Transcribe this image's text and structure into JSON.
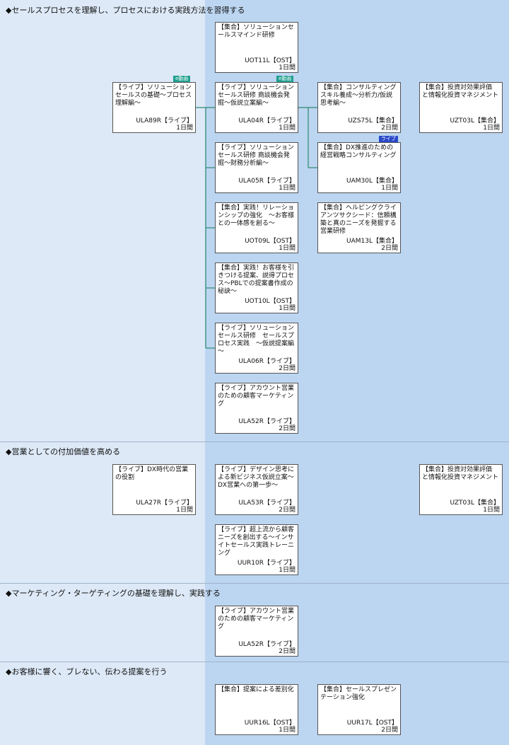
{
  "sections": [
    {
      "title": "◆セールスプロセスを理解し、プロセスにおける実践方法を習得する"
    },
    {
      "title": "◆営業としての付加価値を高める"
    },
    {
      "title": "◆マーケティング・ターゲティングの基礎を理解し、実践する"
    },
    {
      "title": "◆お客様に響く、ブレない、伝わる提案を行う"
    }
  ],
  "badges": {
    "video": "e動画",
    "live": "ライブ"
  },
  "cards": [
    {
      "title": "【集合】ソリューションセールスマインド研修",
      "code": "UOT11L【OST】",
      "duration": "1日間"
    },
    {
      "title": "【ライブ】ソリューションセールスの基礎～プロセス理解編～",
      "code": "ULA89R【ライブ】",
      "duration": "1日間"
    },
    {
      "title": "【ライブ】ソリューションセールス研修 商談機会発掘～仮説立案編～",
      "code": "ULA04R【ライブ】",
      "duration": "1日間"
    },
    {
      "title": "【集合】コンサルティングスキル養成～分析力/仮説思考編～",
      "code": "UZS75L【集合】",
      "duration": "2日間"
    },
    {
      "title": "【集合】投資対効果評価 と情報化投資マネジメント",
      "code": "UZT03L【集合】",
      "duration": "1日間"
    },
    {
      "title": "【ライブ】ソリューションセールス研修 商談機会発掘～財務分析編～",
      "code": "ULA05R【ライブ】",
      "duration": "1日間"
    },
    {
      "title": "【集合】DX推進のための経営戦略コンサルティング",
      "code": "UAM30L【集合】",
      "duration": "1日間"
    },
    {
      "title": "【集合】実践！リレーションシップの強化　～お客様との一体感を創る～",
      "code": "UOT09L【OST】",
      "duration": "1日間"
    },
    {
      "title": "【集合】ヘルピングクライアンツサクシード：信頼構築と真のニーズを発掘する営業研修",
      "code": "UAM13L【集合】",
      "duration": "2日間"
    },
    {
      "title": "【集合】実践！お客様を引きつける提案、説得プロセス～PBLでの提案書作成の秘訣～",
      "code": "UOT10L【OST】",
      "duration": "1日間"
    },
    {
      "title": "【ライブ】ソリューションセールス研修　セールスプロセス実践　～仮説提案編～",
      "code": "ULA06R【ライブ】",
      "duration": "2日間"
    },
    {
      "title": "【ライブ】アカウント営業のための顧客マーケティング",
      "code": "ULA52R【ライブ】",
      "duration": "2日間"
    },
    {
      "title": "【ライブ】DX時代の営業の役割",
      "code": "ULA27R【ライブ】",
      "duration": "1日間"
    },
    {
      "title": "【ライブ】デザイン思考による新ビジネス仮説立案～DX営業への第一歩～",
      "code": "ULA53R【ライブ】",
      "duration": "2日間"
    },
    {
      "title": "【集合】投資対効果評価 と情報化投資マネジメント",
      "code": "UZT03L【集合】",
      "duration": "1日間"
    },
    {
      "title": "【ライブ】超上流から顧客ニーズを創出する～インサイトセールス実践トレーニング",
      "code": "UUR10R【ライブ】",
      "duration": "1日間"
    },
    {
      "title": "【ライブ】アカウント営業のための顧客マーケティング",
      "code": "ULA52R【ライブ】",
      "duration": "2日間"
    },
    {
      "title": "【集合】提案による差別化",
      "code": "UUR16L【OST】",
      "duration": "1日間"
    },
    {
      "title": "【集合】セールスプレゼンテーション強化",
      "code": "UUR17L【OST】",
      "duration": "2日間"
    }
  ]
}
